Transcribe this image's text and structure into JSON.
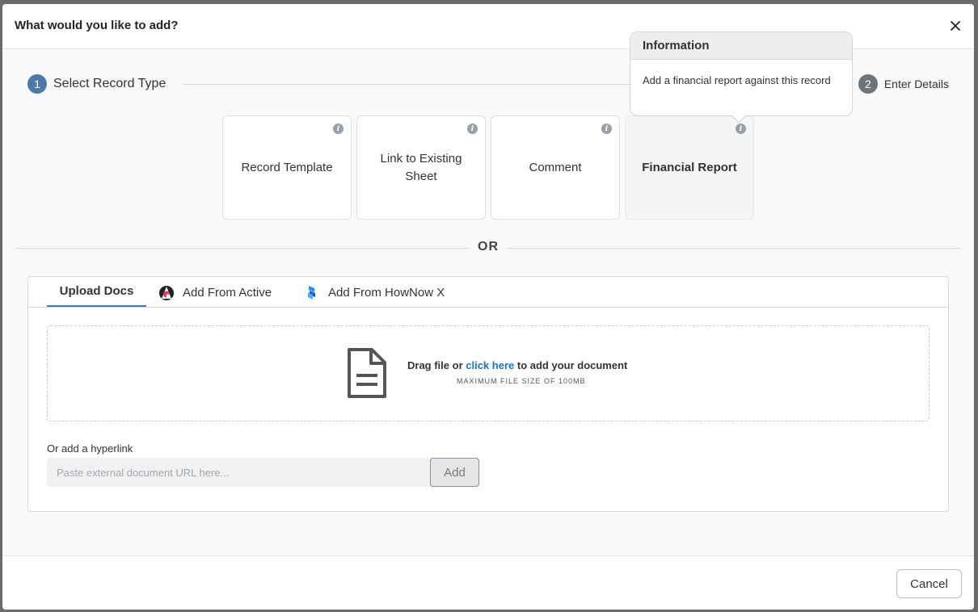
{
  "modal": {
    "title": "What would you like to add?"
  },
  "stepper": {
    "steps": [
      {
        "number": "1",
        "label": "Select Record Type"
      },
      {
        "number": "2",
        "label": "Enter Details"
      }
    ]
  },
  "record_types": [
    {
      "label": "Record Template"
    },
    {
      "label": "Link to Existing Sheet"
    },
    {
      "label": "Comment"
    },
    {
      "label": "Financial Report"
    }
  ],
  "tooltip": {
    "title": "Information",
    "body": "Add a financial report against this record"
  },
  "divider": {
    "label": "OR"
  },
  "upload": {
    "tabs": [
      {
        "label": "Upload Docs"
      },
      {
        "label": "Add From Active"
      },
      {
        "label": "Add From HowNow X"
      }
    ],
    "dropzone": {
      "prefix": "Drag file or ",
      "link": "click here",
      "suffix": " to add your document",
      "subtext": "MAXIMUM FILE SIZE OF 100MB"
    },
    "hyperlink": {
      "label": "Or add a hyperlink",
      "placeholder": "Paste external document URL here...",
      "value": "",
      "button": "Add"
    }
  },
  "footer": {
    "cancel_label": "Cancel"
  },
  "colors": {
    "step_active": "#4a7aa8",
    "step_inactive": "#6f7479",
    "link": "#1a73c8"
  }
}
